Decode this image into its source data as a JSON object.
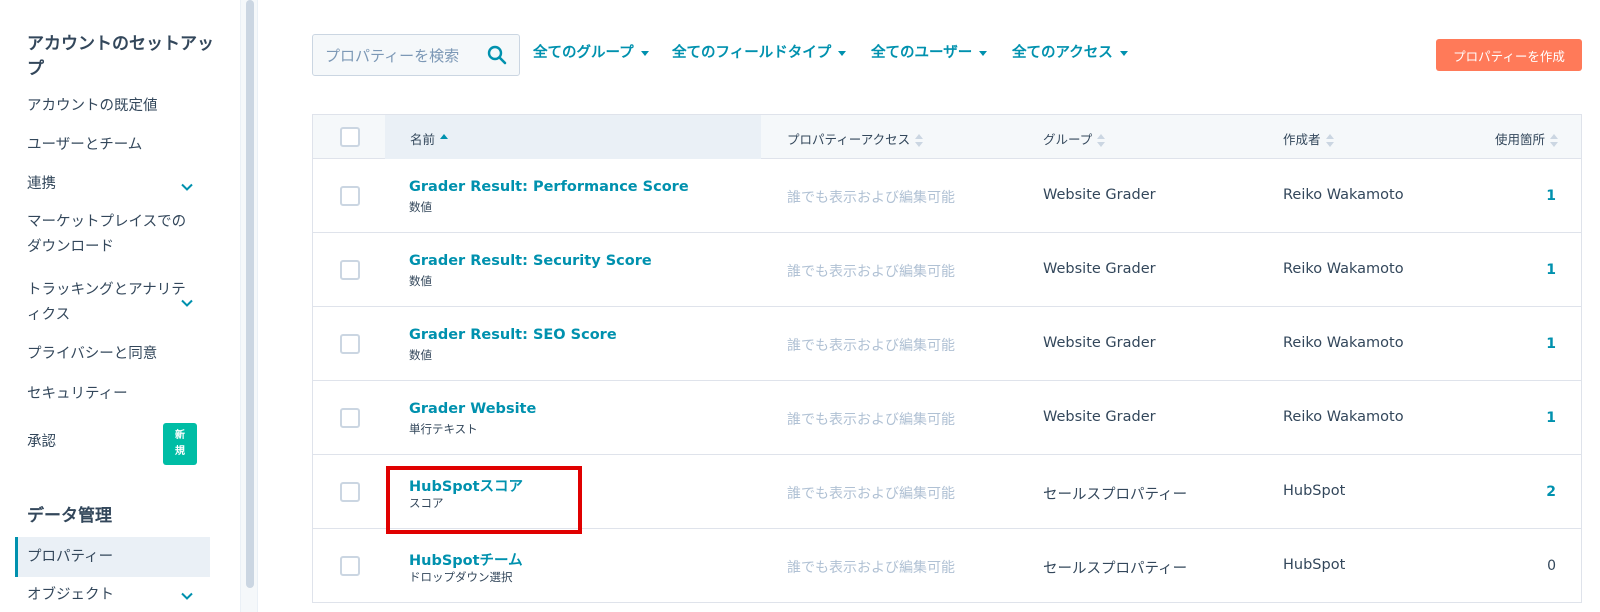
{
  "sidebar": {
    "section1_heading": "アカウントのセットアップ",
    "items": [
      {
        "label": "アカウントの既定値"
      },
      {
        "label": "ユーザーとチーム"
      },
      {
        "label": "連携"
      },
      {
        "label": "マーケットプレイスでのダウンロード"
      },
      {
        "label": "トラッキングとアナリティクス"
      },
      {
        "label": "プライバシーと同意"
      },
      {
        "label": "セキュリティー"
      },
      {
        "label": "承認",
        "badge": "新規"
      }
    ],
    "section2_heading": "データ管理",
    "data_items": [
      {
        "label": "プロパティー",
        "active": true
      },
      {
        "label": "オブジェクト"
      }
    ]
  },
  "toolbar": {
    "search_placeholder": "プロパティーを検索",
    "filters": [
      "全てのグループ",
      "全てのフィールドタイプ",
      "全てのユーザー",
      "全てのアクセス"
    ],
    "create_label": "プロパティーを作成"
  },
  "table": {
    "columns": [
      "名前",
      "プロパティーアクセス",
      "グループ",
      "作成者",
      "使用箇所"
    ],
    "rows": [
      {
        "name": "Grader Result: Performance Score",
        "type": "数値",
        "access": "誰でも表示および編集可能",
        "group": "Website Grader",
        "author": "Reiko Wakamoto",
        "usage": "1"
      },
      {
        "name": "Grader Result: Security Score",
        "type": "数値",
        "access": "誰でも表示および編集可能",
        "group": "Website Grader",
        "author": "Reiko Wakamoto",
        "usage": "1"
      },
      {
        "name": "Grader Result: SEO Score",
        "type": "数値",
        "access": "誰でも表示および編集可能",
        "group": "Website Grader",
        "author": "Reiko Wakamoto",
        "usage": "1"
      },
      {
        "name": "Grader Website",
        "type": "単行テキスト",
        "access": "誰でも表示および編集可能",
        "group": "Website Grader",
        "author": "Reiko Wakamoto",
        "usage": "1"
      },
      {
        "name": "HubSpotスコア",
        "type": "スコア",
        "access": "誰でも表示および編集可能",
        "group": "セールスプロパティー",
        "author": "HubSpot",
        "usage": "2"
      },
      {
        "name": "HubSpotチーム",
        "type": "ドロップダウン選択",
        "access": "誰でも表示および編集可能",
        "group": "セールスプロパティー",
        "author": "HubSpot",
        "usage": "0"
      }
    ]
  },
  "colors": {
    "accent": "#0091ae",
    "create_button": "#ff7a59",
    "badge": "#00bda5",
    "highlight": "#e00000"
  }
}
